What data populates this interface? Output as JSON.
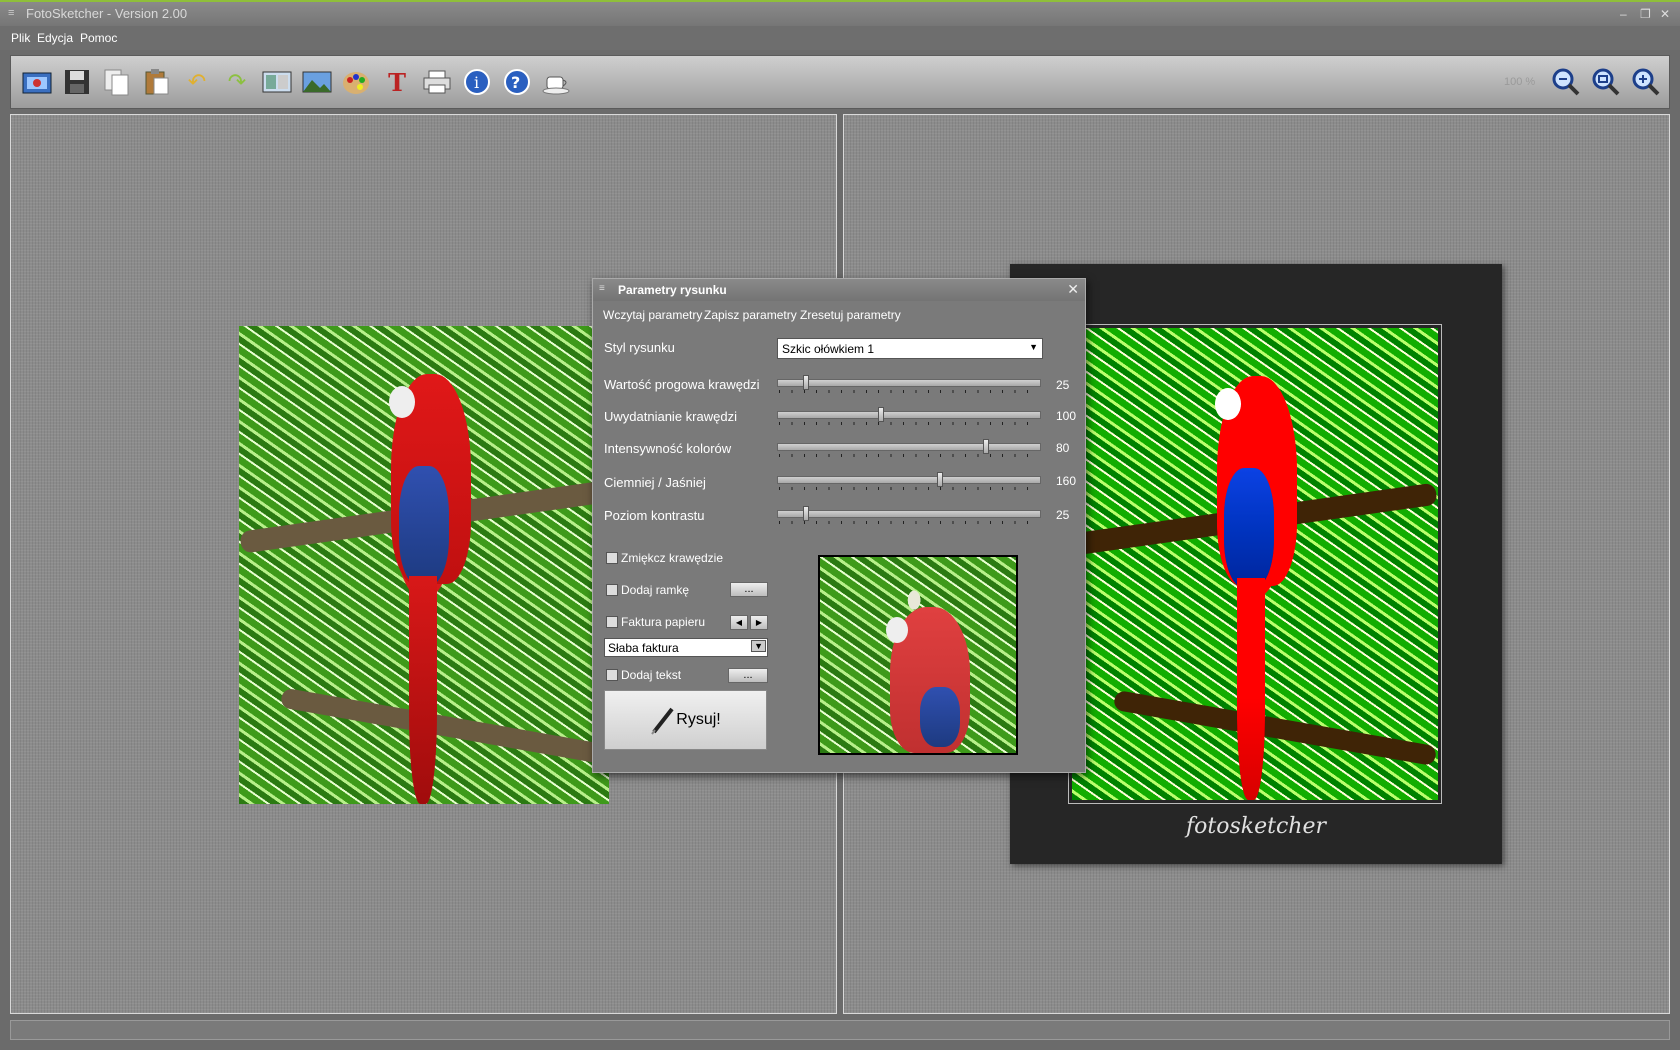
{
  "window": {
    "title": "FotoSketcher - Version 2.00",
    "sys_icon": "≡",
    "minimize": "–",
    "restore": "❐",
    "close": "✕"
  },
  "menu": {
    "file": "Plik",
    "edit": "Edycja",
    "help": "Pomoc"
  },
  "toolbar": {
    "icons": [
      "open-image-icon",
      "save-icon",
      "copy-icon",
      "paste-icon",
      "undo-icon",
      "redo-icon",
      "compare-icon",
      "landscape-icon",
      "palette-icon",
      "text-icon",
      "print-icon",
      "info-icon",
      "help-icon",
      "coffee-icon"
    ],
    "zoom_level": "100 %",
    "zoom_icons": [
      "zoom-out-icon",
      "zoom-reset-icon",
      "zoom-in-icon"
    ]
  },
  "sketch": {
    "signature": "fotosketcher"
  },
  "dialog": {
    "title": "Parametry rysunku",
    "close": "✕",
    "menu": {
      "load": "Wczytaj parametry",
      "save": "Zapisz parametry",
      "reset": "Zresetuj parametry"
    },
    "style_label": "Styl rysunku",
    "style_value": "Szkic ołówkiem 1",
    "sliders": [
      {
        "label": "Wartość progowa krawędzi",
        "value": "25",
        "fraction": 0.1
      },
      {
        "label": "Uwydatnianie krawędzi",
        "value": "100",
        "fraction": 0.39
      },
      {
        "label": "Intensywność kolorów",
        "value": "80",
        "fraction": 0.8
      },
      {
        "label": "Ciemniej / Jaśniej",
        "value": "160",
        "fraction": 0.62
      },
      {
        "label": "Poziom kontrastu",
        "value": "25",
        "fraction": 0.1
      }
    ],
    "soften_edges": "Zmiękcz krawędzie",
    "add_frame": "Dodaj ramkę",
    "paper_texture": "Faktura papieru",
    "texture_value": "Słaba faktura",
    "add_text": "Dodaj tekst",
    "ellipsis": "...",
    "draw_button": "Rysuj!"
  }
}
